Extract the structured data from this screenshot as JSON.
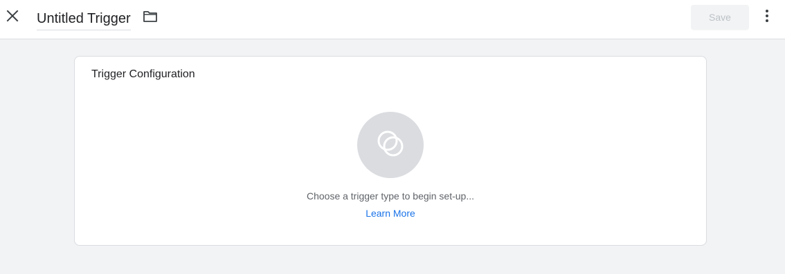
{
  "header": {
    "title": "Untitled Trigger",
    "save_label": "Save",
    "icons": {
      "close": "close-icon",
      "folder": "folder-icon",
      "more": "more-vert-icon"
    }
  },
  "card": {
    "title": "Trigger Configuration",
    "hint": "Choose a trigger type to begin set-up...",
    "learn_more": "Learn More",
    "icon": "trigger-type-icon"
  },
  "colors": {
    "page_bg": "#f1f3f4",
    "card_bg": "#ffffff",
    "link": "#1a73e8",
    "placeholder_circle": "#dadce0",
    "save_disabled_text": "#bdc1c6"
  }
}
